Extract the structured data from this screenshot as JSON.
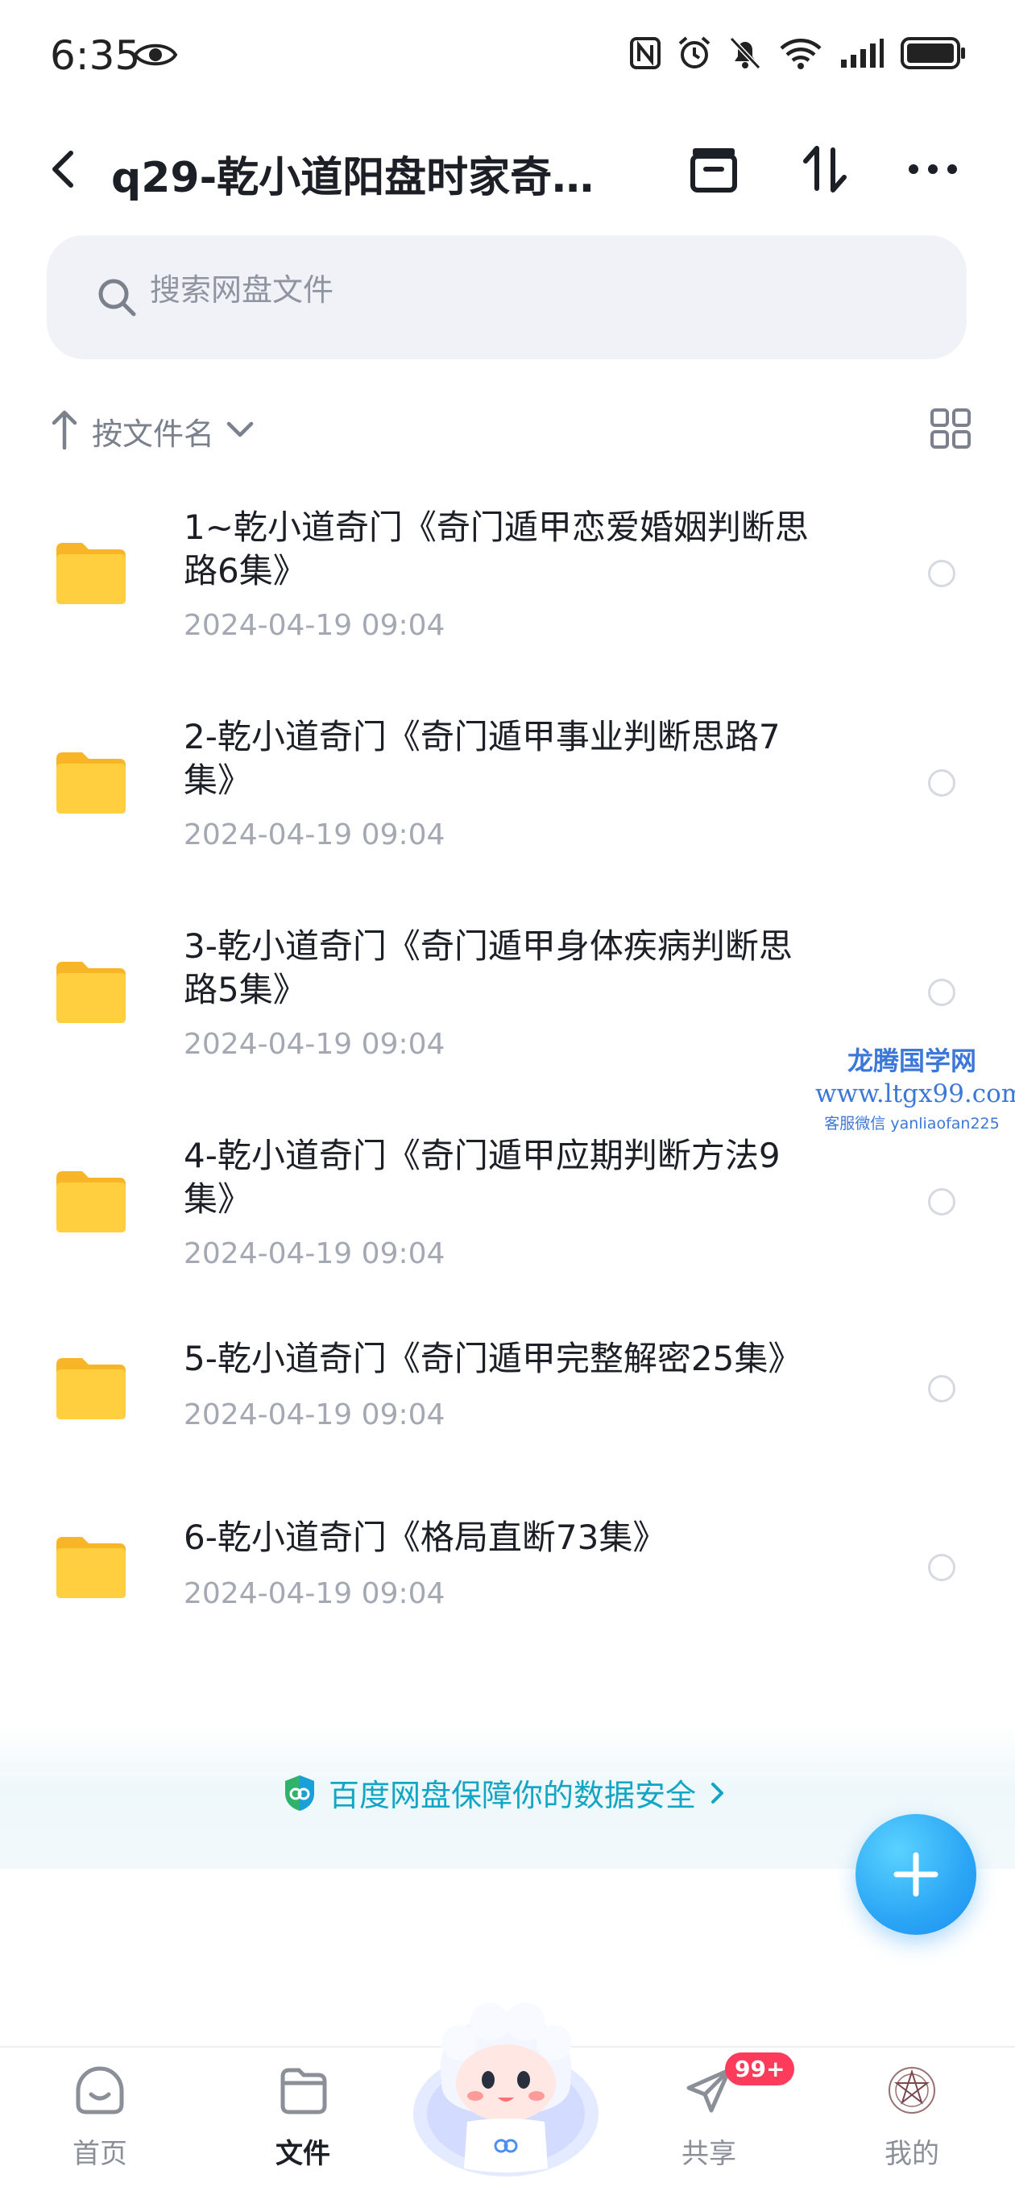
{
  "status_bar": {
    "time": "6:35"
  },
  "header": {
    "title": "q29-乾小道阳盘时家奇…"
  },
  "search": {
    "placeholder": "搜索网盘文件"
  },
  "sort": {
    "label": "按文件名"
  },
  "files": [
    {
      "name_line1": "1~乾小道奇门《奇门遁甲恋爱婚姻判断思",
      "name_line2": "路6集》",
      "date": "2024-04-19  09:04"
    },
    {
      "name_line1": "2-乾小道奇门《奇门遁甲事业判断思路7",
      "name_line2": "集》",
      "date": "2024-04-19  09:04"
    },
    {
      "name_line1": "3-乾小道奇门《奇门遁甲身体疾病判断思",
      "name_line2": "路5集》",
      "date": "2024-04-19  09:04"
    },
    {
      "name_line1": "4-乾小道奇门《奇门遁甲应期判断方法9",
      "name_line2": "集》",
      "date": "2024-04-19  09:04"
    },
    {
      "name_line1": "5-乾小道奇门《奇门遁甲完整解密25集》",
      "name_line2": "",
      "date": "2024-04-19  09:04"
    },
    {
      "name_line1": "6-乾小道奇门《格局直断73集》",
      "name_line2": "",
      "date": "2024-04-19  09:04"
    }
  ],
  "watermark": {
    "title": "龙腾国学网",
    "url": "www.ltgx99.com",
    "wechat": "客服微信 yanliaofan225"
  },
  "security_banner": {
    "text": "百度网盘保障你的数据安全"
  },
  "bottom_nav": {
    "home": "首页",
    "files": "文件",
    "share": "共享",
    "share_badge": "99+",
    "mine": "我的"
  },
  "colors": {
    "accent": "#13a5c4",
    "folder": "#ffc93c",
    "fab": "#2ba6f5",
    "badge": "#ff3b5c"
  }
}
